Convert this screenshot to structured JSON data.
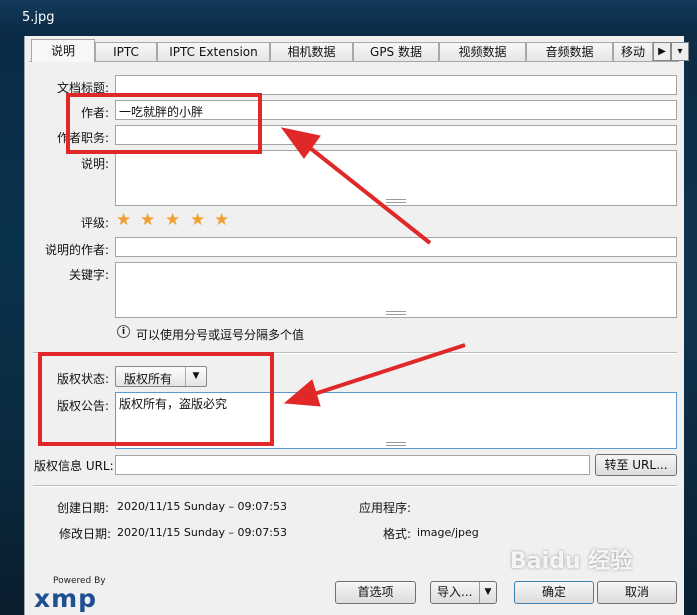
{
  "window": {
    "title": "5.jpg"
  },
  "tabs": [
    {
      "label": "说明"
    },
    {
      "label": "IPTC"
    },
    {
      "label": "IPTC Extension"
    },
    {
      "label": "相机数据"
    },
    {
      "label": "GPS 数据"
    },
    {
      "label": "视频数据"
    },
    {
      "label": "音频数据"
    },
    {
      "label": "移动"
    }
  ],
  "fields": {
    "doc_title": {
      "label": "文档标题:",
      "value": ""
    },
    "author": {
      "label": "作者:",
      "value": "一吃就胖的小胖"
    },
    "author_title": {
      "label": "作者职务:",
      "value": ""
    },
    "description": {
      "label": "说明:",
      "value": ""
    },
    "rating": {
      "label": "评级:",
      "stars": 5
    },
    "desc_writer": {
      "label": "说明的作者:",
      "value": ""
    },
    "keywords": {
      "label": "关键字:",
      "value": ""
    },
    "hint": "可以使用分号或逗号分隔多个值",
    "copyright_status": {
      "label": "版权状态:",
      "value": "版权所有"
    },
    "copyright_notice": {
      "label": "版权公告:",
      "value": "版权所有，盗版必究"
    },
    "copyright_url": {
      "label": "版权信息 URL:",
      "value": "",
      "goto_label": "转至 URL..."
    }
  },
  "info": {
    "created_label": "创建日期:",
    "created_value": "2020/11/15 Sunday – 09:07:53",
    "modified_label": "修改日期:",
    "modified_value": "2020/11/15 Sunday – 09:07:53",
    "app_label": "应用程序:",
    "app_value": "",
    "format_label": "格式:",
    "format_value": "image/jpeg"
  },
  "footer": {
    "logo_powered": "Powered By",
    "logo_xmp": "xmp",
    "prefs_label": "首选项",
    "import_label": "导入...",
    "ok_label": "确定",
    "cancel_label": "取消"
  },
  "watermark": "Baidu 经验",
  "colors": {
    "annotation": "#e02828",
    "star": "#f0a030",
    "xmp_blue": "#1d4f91"
  }
}
